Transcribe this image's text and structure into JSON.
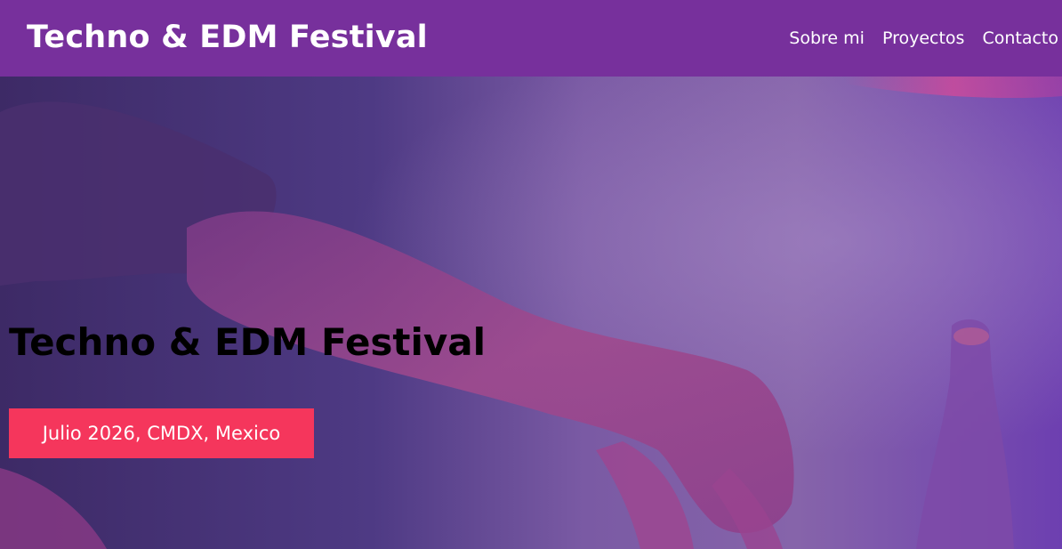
{
  "header": {
    "brand": "Techno & EDM Festival",
    "nav": [
      {
        "label": "Sobre mi"
      },
      {
        "label": "Proyectos"
      },
      {
        "label": "Contacto"
      }
    ]
  },
  "hero": {
    "title": "Techno & EDM Festival",
    "date_location": "Julio 2026, CMDX, Mexico"
  },
  "colors": {
    "header_bg": "#77309c",
    "badge_bg": "#f5365c",
    "hero_overlay": "#6a3aa0"
  }
}
